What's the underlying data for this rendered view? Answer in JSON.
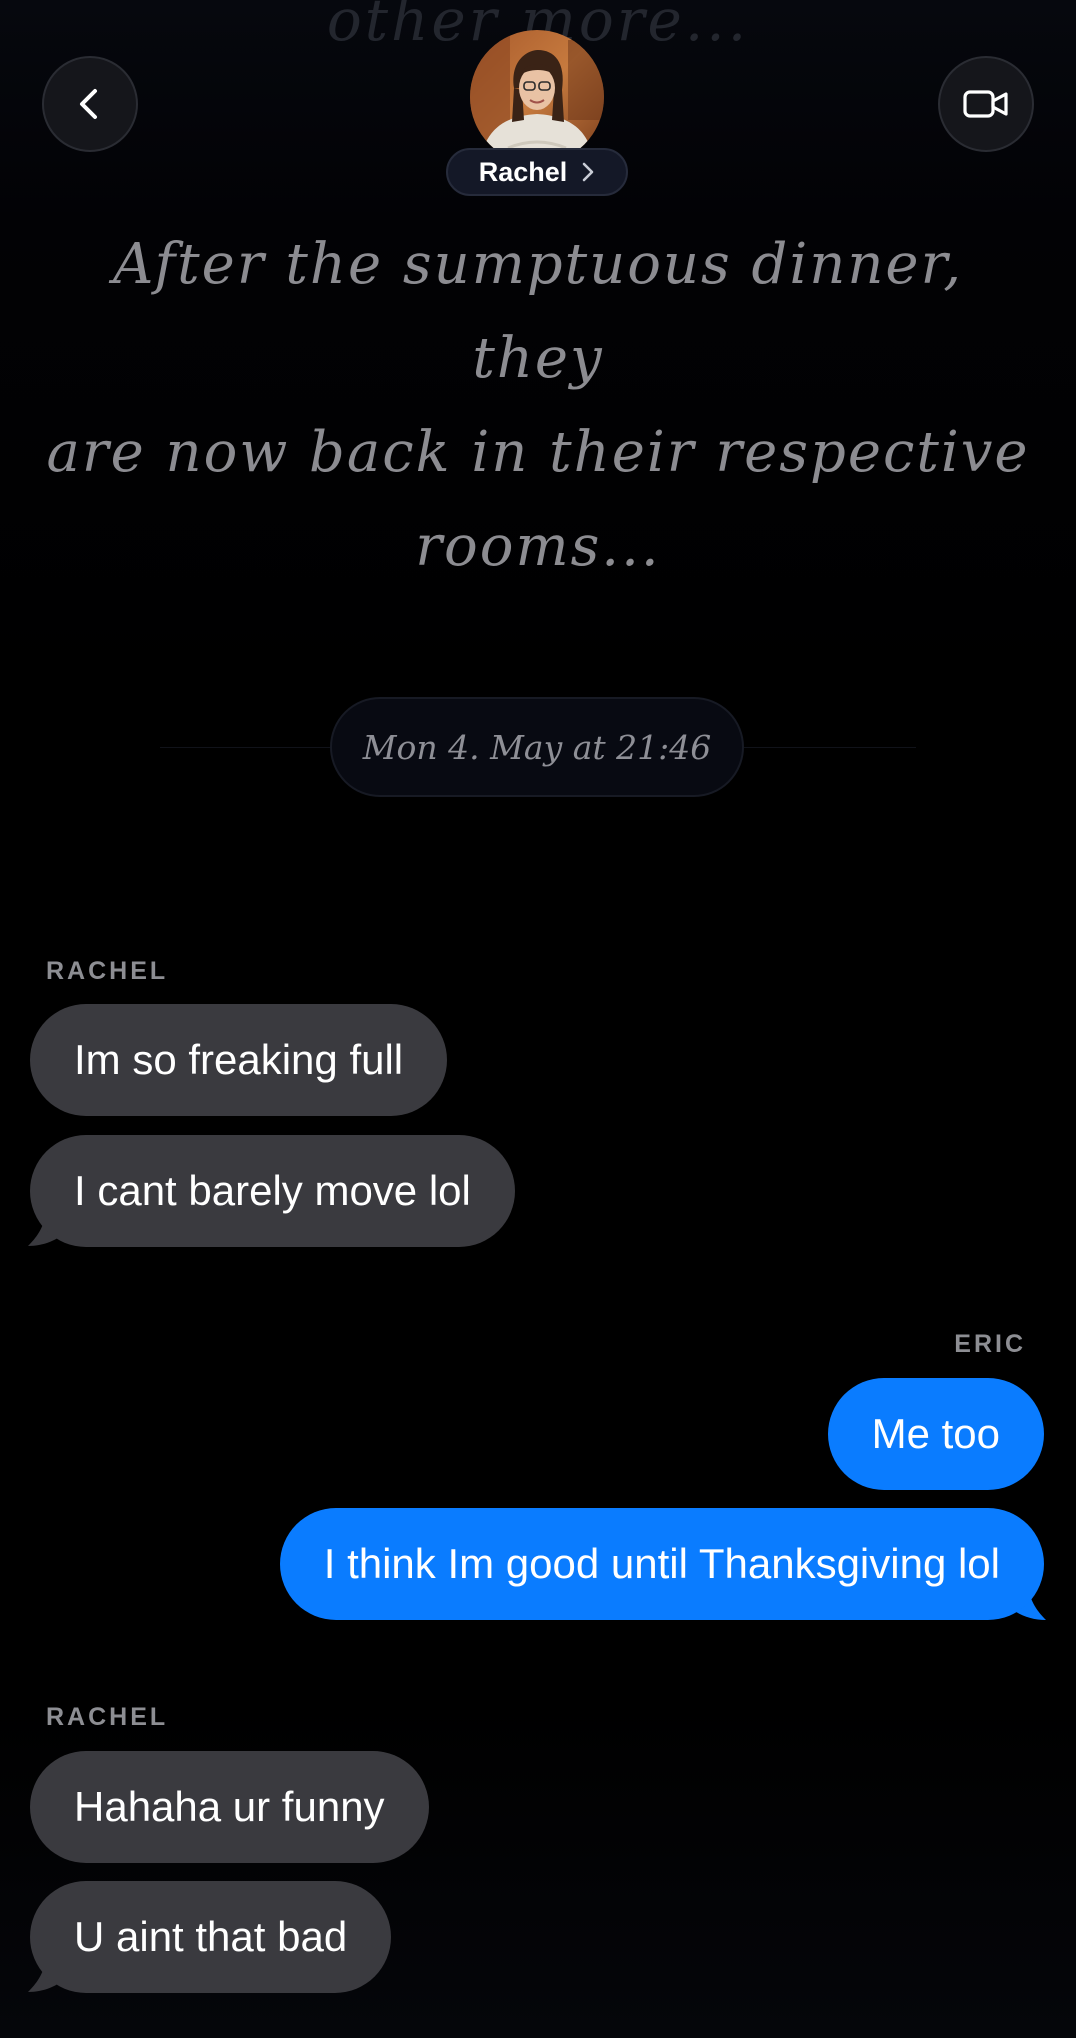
{
  "header": {
    "faded_text": "other more...",
    "contact_name": "Rachel",
    "back_icon": "chevron-left-icon",
    "video_icon": "video-camera-icon",
    "chevron_icon": "chevron-right-icon"
  },
  "narration": {
    "line1": "After the sumptuous dinner, they",
    "line2": "are now back in their respective",
    "line3": "rooms..."
  },
  "date_separator": "Mon 4. May at 21:46",
  "conversation": {
    "group1": {
      "sender": "RACHEL",
      "messages": [
        "Im so freaking full",
        "I cant barely move lol"
      ]
    },
    "group2": {
      "sender": "ERIC",
      "messages": [
        "Me too",
        "I think Im good until Thanksgiving lol"
      ]
    },
    "group3": {
      "sender": "RACHEL",
      "messages": [
        "Hahaha ur funny",
        "U aint that bad"
      ]
    }
  },
  "colors": {
    "incoming_bubble": "#3a3a3f",
    "outgoing_bubble": "#0a7cff",
    "background": "#000000"
  }
}
